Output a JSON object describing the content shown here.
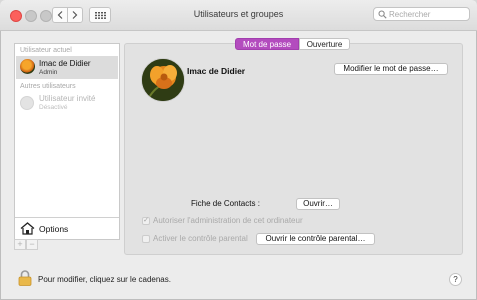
{
  "window": {
    "title": "Utilisateurs et groupes"
  },
  "search": {
    "placeholder": "Rechercher"
  },
  "sidebar": {
    "current_header": "Utilisateur actuel",
    "current_user": {
      "name": "Imac de Didier",
      "role": "Admin"
    },
    "others_header": "Autres utilisateurs",
    "guest_user": {
      "name": "Utilisateur invité",
      "status": "Désactivé"
    },
    "options_label": "Options",
    "add_label": "+",
    "remove_label": "−"
  },
  "tabs": [
    {
      "label": "Mot de passe",
      "selected": true
    },
    {
      "label": "Ouverture",
      "selected": false
    }
  ],
  "main": {
    "user_name": "Imac de Didier",
    "change_password_label": "Modifier le mot de passe…",
    "contacts_label": "Fiche de Contacts :",
    "contacts_open_label": "Ouvrir…",
    "allow_admin_label": "Autoriser l'administration de cet ordinateur",
    "allow_admin_checked": true,
    "parental_label": "Activer le contrôle parental",
    "parental_checked": false,
    "open_parental_label": "Ouvrir le contrôle parental…"
  },
  "footer": {
    "lock_text": "Pour modifier, cliquez sur le cadenas.",
    "help_label": "?"
  },
  "colors": {
    "accent_tab": "#b34cbe",
    "close_button": "#fc605c",
    "selection": "#dcdcdc"
  },
  "icons": [
    "close-icon",
    "back-icon",
    "forward-icon",
    "grid-icon",
    "search-icon",
    "home-icon",
    "lock-icon",
    "help-icon"
  ]
}
